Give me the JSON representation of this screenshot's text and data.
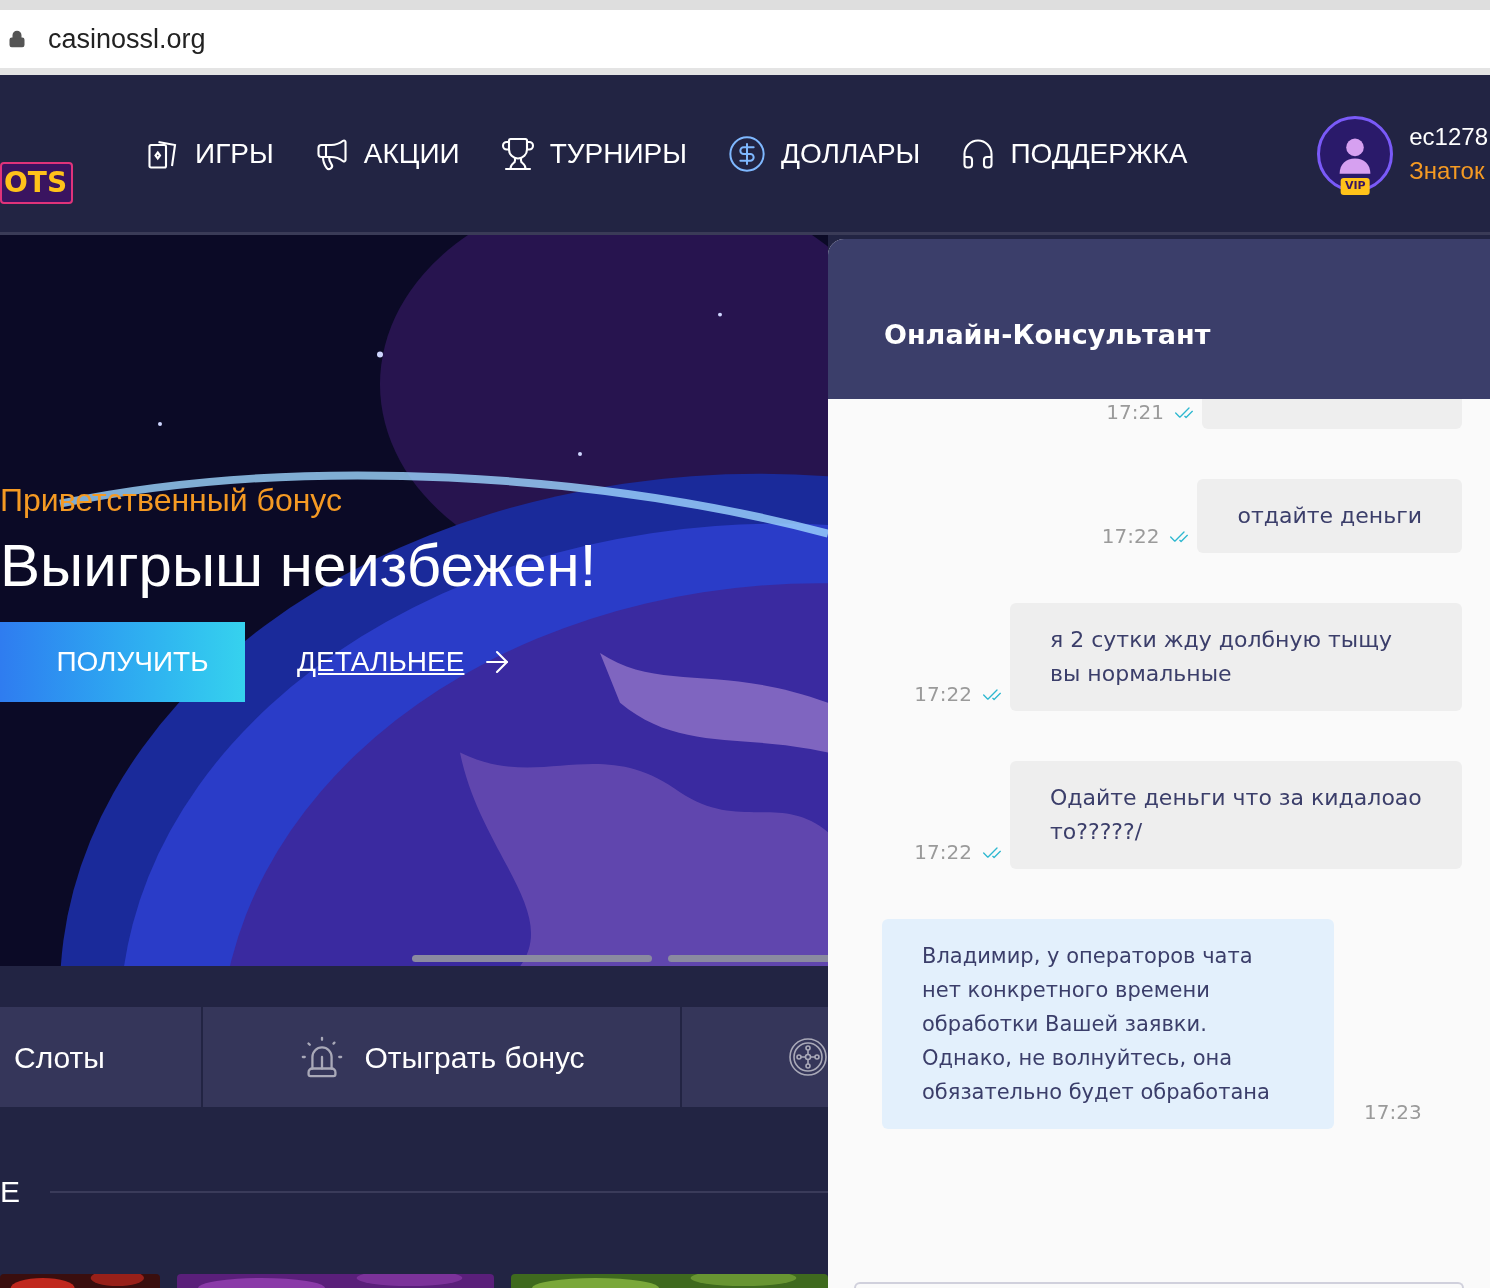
{
  "browser": {
    "url": "casinossl.org"
  },
  "header": {
    "logo": "OTS",
    "nav": [
      {
        "label": "ИГРЫ"
      },
      {
        "label": "АКЦИИ"
      },
      {
        "label": "ТУРНИРЫ"
      },
      {
        "label": "ДОЛЛАРЫ"
      },
      {
        "label": "ПОДДЕРЖКА"
      }
    ],
    "user": {
      "badge": "VIP",
      "name": "ec1278",
      "rank": "Знаток"
    }
  },
  "hero": {
    "kind": "picture",
    "subtitle": "Приветственный бонус",
    "title": "Выигрыш неизбежен!",
    "primary_button": "ПОЛУЧИТЬ",
    "link": "ДЕТАЛЬНЕЕ"
  },
  "categories": [
    {
      "label": "Слоты"
    },
    {
      "label": "Отыграть бонус"
    }
  ],
  "section": {
    "title": "Е"
  },
  "chat": {
    "title": "Онлайн-Консультант",
    "messages": [
      {
        "kind": "outgoing",
        "time": "17:21"
      },
      {
        "kind": "outgoing",
        "time": "17:22",
        "text": "отдайте деньги"
      },
      {
        "kind": "outgoing",
        "time": "17:22",
        "text": "я 2 сутки жду долбную тыщу вы нормальные"
      },
      {
        "kind": "outgoing",
        "time": "17:22",
        "text": "Одайте деньги что за кидалоао то?????/"
      },
      {
        "kind": "incoming",
        "time": "17:23",
        "text": "Владимир, у операторов чата нет конкретного времени обработки Вашей заявки. Однако, не волнуйтесь, она обязательно будет обработана"
      }
    ]
  }
}
